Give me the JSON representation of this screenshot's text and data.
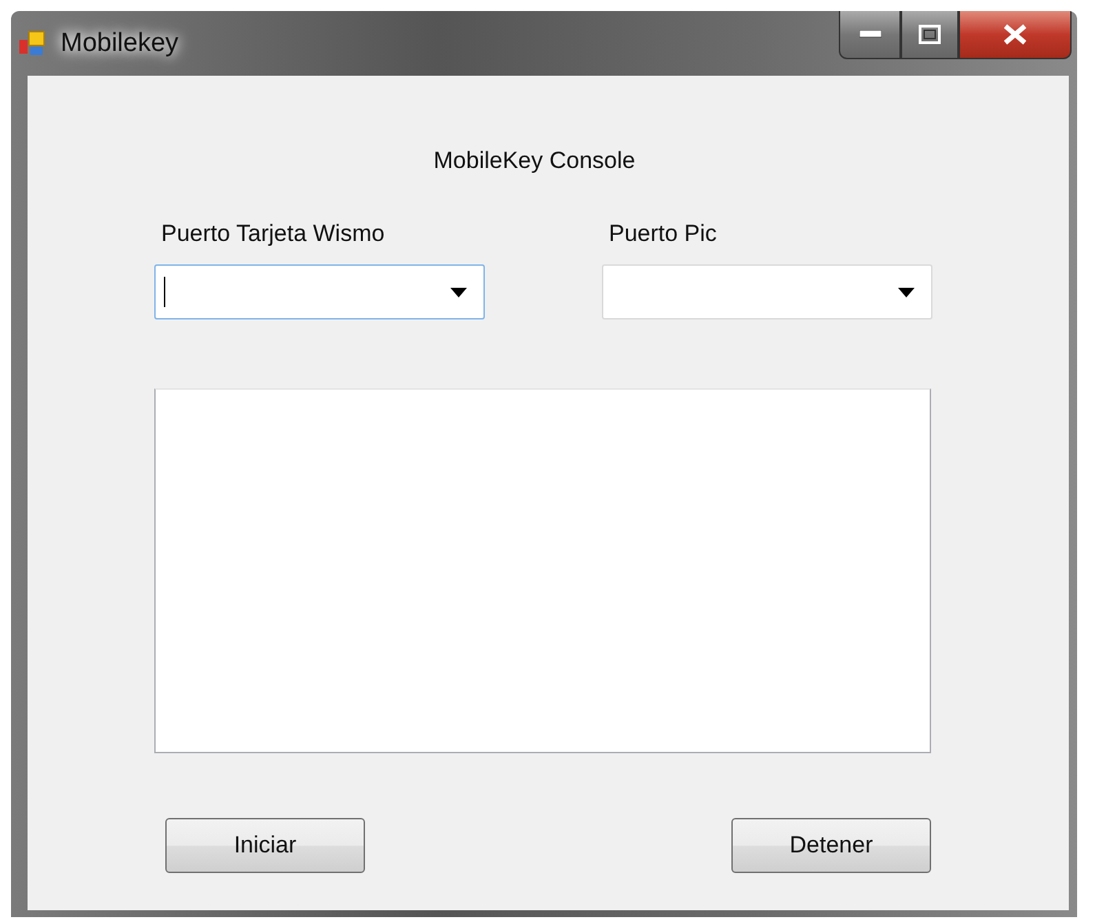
{
  "window": {
    "title": "Mobilekey"
  },
  "heading": "MobileKey Console",
  "ports": [
    {
      "label": "Puerto Tarjeta Wismo",
      "focused": true
    },
    {
      "label": "Puerto Pic",
      "focused": false
    }
  ],
  "buttons": [
    {
      "label": "Iniciar"
    },
    {
      "label": "Detener"
    }
  ]
}
